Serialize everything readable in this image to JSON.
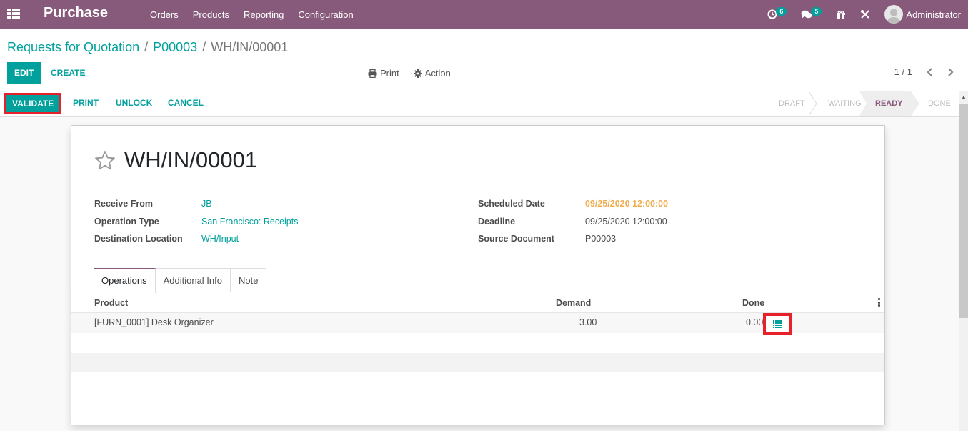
{
  "navbar": {
    "apps_icon": "apps-grid-icon",
    "brand": "Purchase",
    "menu": [
      "Orders",
      "Products",
      "Reporting",
      "Configuration"
    ],
    "systray": {
      "activity_icon": "clock-icon",
      "activity_count": "6",
      "messages_icon": "chat-icon",
      "messages_count": "5",
      "gift_icon": "gift-icon",
      "tools_icon": "tools-icon",
      "user_name": "Administrator"
    }
  },
  "control_panel": {
    "breadcrumb": [
      "Requests for Quotation",
      "P00003",
      "WH/IN/00001"
    ],
    "breadcrumb_separator": "/",
    "edit_label": "EDIT",
    "create_label": "CREATE",
    "print_label": "Print",
    "action_label": "Action",
    "pager_value": "1 / 1",
    "pager_prev": "‹",
    "pager_next": "›"
  },
  "header": {
    "validate_label": "VALIDATE",
    "print_label": "PRINT",
    "unlock_label": "UNLOCK",
    "cancel_label": "CANCEL",
    "stages": [
      "DRAFT",
      "WAITING",
      "READY",
      "DONE"
    ],
    "current_stage": "READY"
  },
  "record": {
    "title": "WH/IN/00001",
    "favorite": false,
    "left_fields": [
      {
        "label": "Receive From",
        "value": "JB"
      },
      {
        "label": "Operation Type",
        "value": "San Francisco: Receipts"
      },
      {
        "label": "Destination Location",
        "value": "WH/Input"
      }
    ],
    "right_fields": [
      {
        "label": "Scheduled Date",
        "value": "09/25/2020 12:00:00"
      },
      {
        "label": "Deadline",
        "value": "09/25/2020 12:00:00"
      },
      {
        "label": "Source Document",
        "value": "P00003"
      }
    ]
  },
  "tabs": [
    "Operations",
    "Additional Info",
    "Note"
  ],
  "active_tab": "Operations",
  "operations": {
    "columns": [
      "Product",
      "Demand",
      "Done"
    ],
    "rows": [
      {
        "product": "[FURN_0001] Desk Organizer",
        "demand": "3.00",
        "done": "0.00"
      }
    ]
  },
  "colors": {
    "brand": "#875a7b",
    "accent": "#00a09d",
    "warning": "#f0ad4e",
    "highlight_box": "#e8202a"
  }
}
